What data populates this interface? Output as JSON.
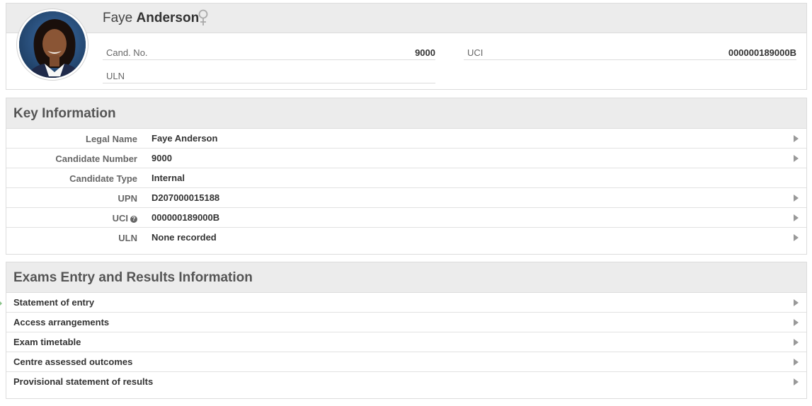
{
  "profile": {
    "first_name": "Faye",
    "last_name": "Anderson",
    "gender_icon": "female-symbol-icon",
    "fields": {
      "cand_no": {
        "label": "Cand. No.",
        "value": "9000"
      },
      "uci": {
        "label": "UCI",
        "value": "000000189000B"
      },
      "uln": {
        "label": "ULN",
        "value": ""
      }
    }
  },
  "key_information": {
    "title": "Key Information",
    "rows": [
      {
        "label": "Legal Name",
        "value": "Faye Anderson",
        "has_arrow": true
      },
      {
        "label": "Candidate Number",
        "value": "9000",
        "has_arrow": true
      },
      {
        "label": "Candidate Type",
        "value": "Internal",
        "has_arrow": false
      },
      {
        "label": "UPN",
        "value": "D207000015188",
        "has_arrow": true
      },
      {
        "label": "UCI",
        "value": "000000189000B",
        "has_arrow": true,
        "help_icon": "?"
      },
      {
        "label": "ULN",
        "value": "None recorded",
        "has_arrow": true
      }
    ]
  },
  "exams": {
    "title": "Exams Entry and Results Information",
    "items": [
      {
        "label": "Statement of entry"
      },
      {
        "label": "Access arrangements"
      },
      {
        "label": "Exam timetable"
      },
      {
        "label": "Centre assessed outcomes"
      },
      {
        "label": "Provisional statement of results"
      }
    ]
  },
  "colors": {
    "header_bg": "#ececec",
    "border": "#dcdcdc",
    "arrow": "#999999"
  }
}
